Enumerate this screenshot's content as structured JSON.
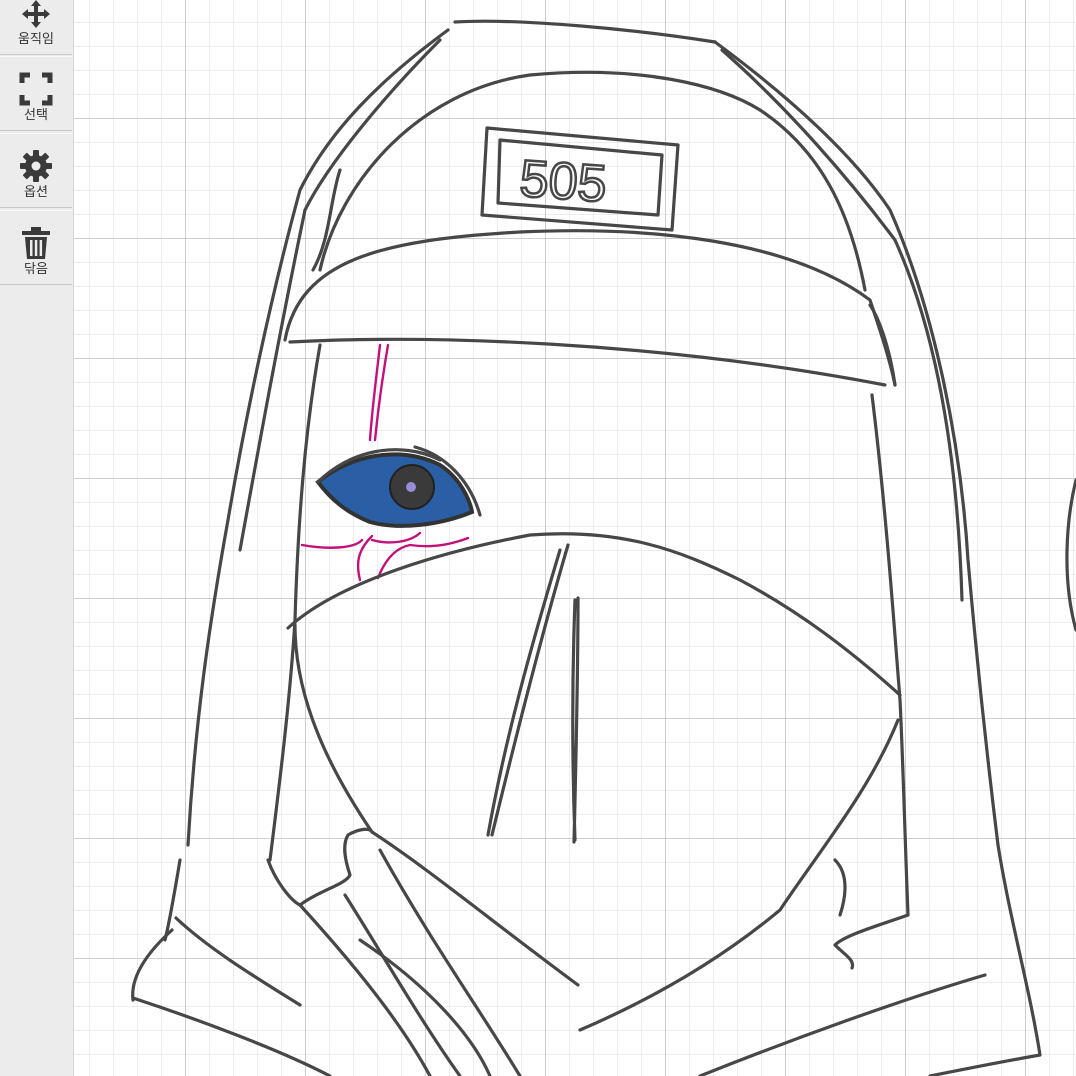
{
  "toolbar": {
    "tools": [
      {
        "label": "움직임",
        "icon": "move-icon"
      },
      {
        "label": "선택",
        "icon": "select-icon"
      },
      {
        "label": "옵션",
        "icon": "gear-icon"
      },
      {
        "label": "닦음",
        "icon": "trash-icon"
      }
    ]
  },
  "drawing": {
    "patch_text": "505",
    "colors": {
      "ink": "#474747",
      "eye_fill": "#2a5fa5",
      "vein": "#c2127a",
      "pupil_highlight": "#9b8ad8",
      "toolbar_bg": "#ececec",
      "grid": "#d7d7d7"
    }
  }
}
